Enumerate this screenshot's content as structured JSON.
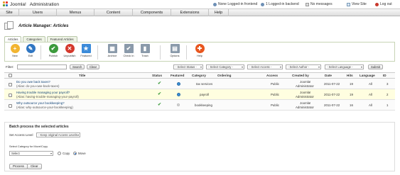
{
  "header": {
    "app_name": "Joomla!",
    "title": "Administration",
    "status": {
      "frontend": "None Logged-in frontend",
      "backend": "1 Logged-in backend",
      "messages": "No messages",
      "view_site": "View Site",
      "logout": "Log out"
    }
  },
  "menu": [
    "Site",
    "Users",
    "Menus",
    "Content",
    "Components",
    "Extensions",
    "Help"
  ],
  "page": {
    "title": "Article Manager: Articles"
  },
  "subtabs": [
    "Articles",
    "Categories",
    "Featured Articles"
  ],
  "toolbar": {
    "buttons": [
      {
        "label": "New",
        "icon": "new-icon",
        "color": "#f2b530",
        "glyph": "+"
      },
      {
        "label": "Edit",
        "icon": "edit-icon",
        "color": "#2f76c2",
        "glyph": "✎"
      },
      {
        "label": "Publish",
        "icon": "publish-icon",
        "color": "#3c9a3c",
        "glyph": "✔"
      },
      {
        "label": "Unpublish",
        "icon": "unpublish-icon",
        "color": "#d4382c",
        "glyph": "✕"
      },
      {
        "label": "Featured",
        "icon": "featured-icon",
        "color": "#3b8bd9",
        "glyph": "★"
      },
      {
        "label": "Archive",
        "icon": "archive-icon",
        "color": "#8a9aaa",
        "glyph": "▦"
      },
      {
        "label": "Check In",
        "icon": "checkin-icon",
        "color": "#8a9aaa",
        "glyph": "✔"
      },
      {
        "label": "Trash",
        "icon": "trash-icon",
        "color": "#8a9aaa",
        "glyph": "▮"
      },
      {
        "label": "Options",
        "icon": "options-icon",
        "color": "#8a9aaa",
        "glyph": "▤"
      },
      {
        "label": "Help",
        "icon": "help-icon",
        "color": "#e8561e",
        "glyph": "✚"
      }
    ]
  },
  "filter": {
    "label": "Filter:",
    "search_label": "Search",
    "clear_label": "Clear",
    "selects": [
      "- Select Status -",
      "- Select Category -",
      "- Select Access -",
      "- Select Author -",
      "- Select Language -",
      "Submit"
    ]
  },
  "table": {
    "columns": [
      "Title",
      "Status",
      "Featured",
      "Category",
      "Ordering",
      "Access",
      "Created by",
      "Date",
      "Hits",
      "Language",
      "ID"
    ],
    "rows": [
      {
        "title": "Do you owe back taxes?",
        "alias": "(Alias: do-you-owe-back-taxes)",
        "status": "published",
        "featured": true,
        "category": "tax services",
        "access": "Public",
        "author1": "Joomla!",
        "author2": "Administrator",
        "date": "2011-07-22",
        "hits": "19",
        "language": "All",
        "id": "3"
      },
      {
        "title": "Having trouble managing your payroll?",
        "alias": "(Alias: having-trouble-managing-your-payroll)",
        "status": "published",
        "featured": true,
        "category": "payroll",
        "access": "Public",
        "author1": "Joomla!",
        "author2": "Administrator",
        "date": "2011-07-22",
        "hits": "19",
        "language": "All",
        "id": "2"
      },
      {
        "title": "Why outsource your bookkeeping?",
        "alias": "(Alias: why-outsource-your-bookkeeping)",
        "status": "published",
        "featured": false,
        "category": "bookkeeping",
        "access": "Public",
        "author1": "Joomla!",
        "author2": "Administrator",
        "date": "2011-07-22",
        "hits": "16",
        "language": "All",
        "id": "1"
      }
    ]
  },
  "batch": {
    "title": "Batch process the selected articles",
    "access_label": "Set Access Level",
    "access_value": "- Keep original Access Levels -",
    "category_label": "Select Category for Move/Copy",
    "category_value": "Select",
    "copy_label": "Copy",
    "move_label": "Move",
    "process_label": "Process",
    "clear_label": "Clear"
  }
}
